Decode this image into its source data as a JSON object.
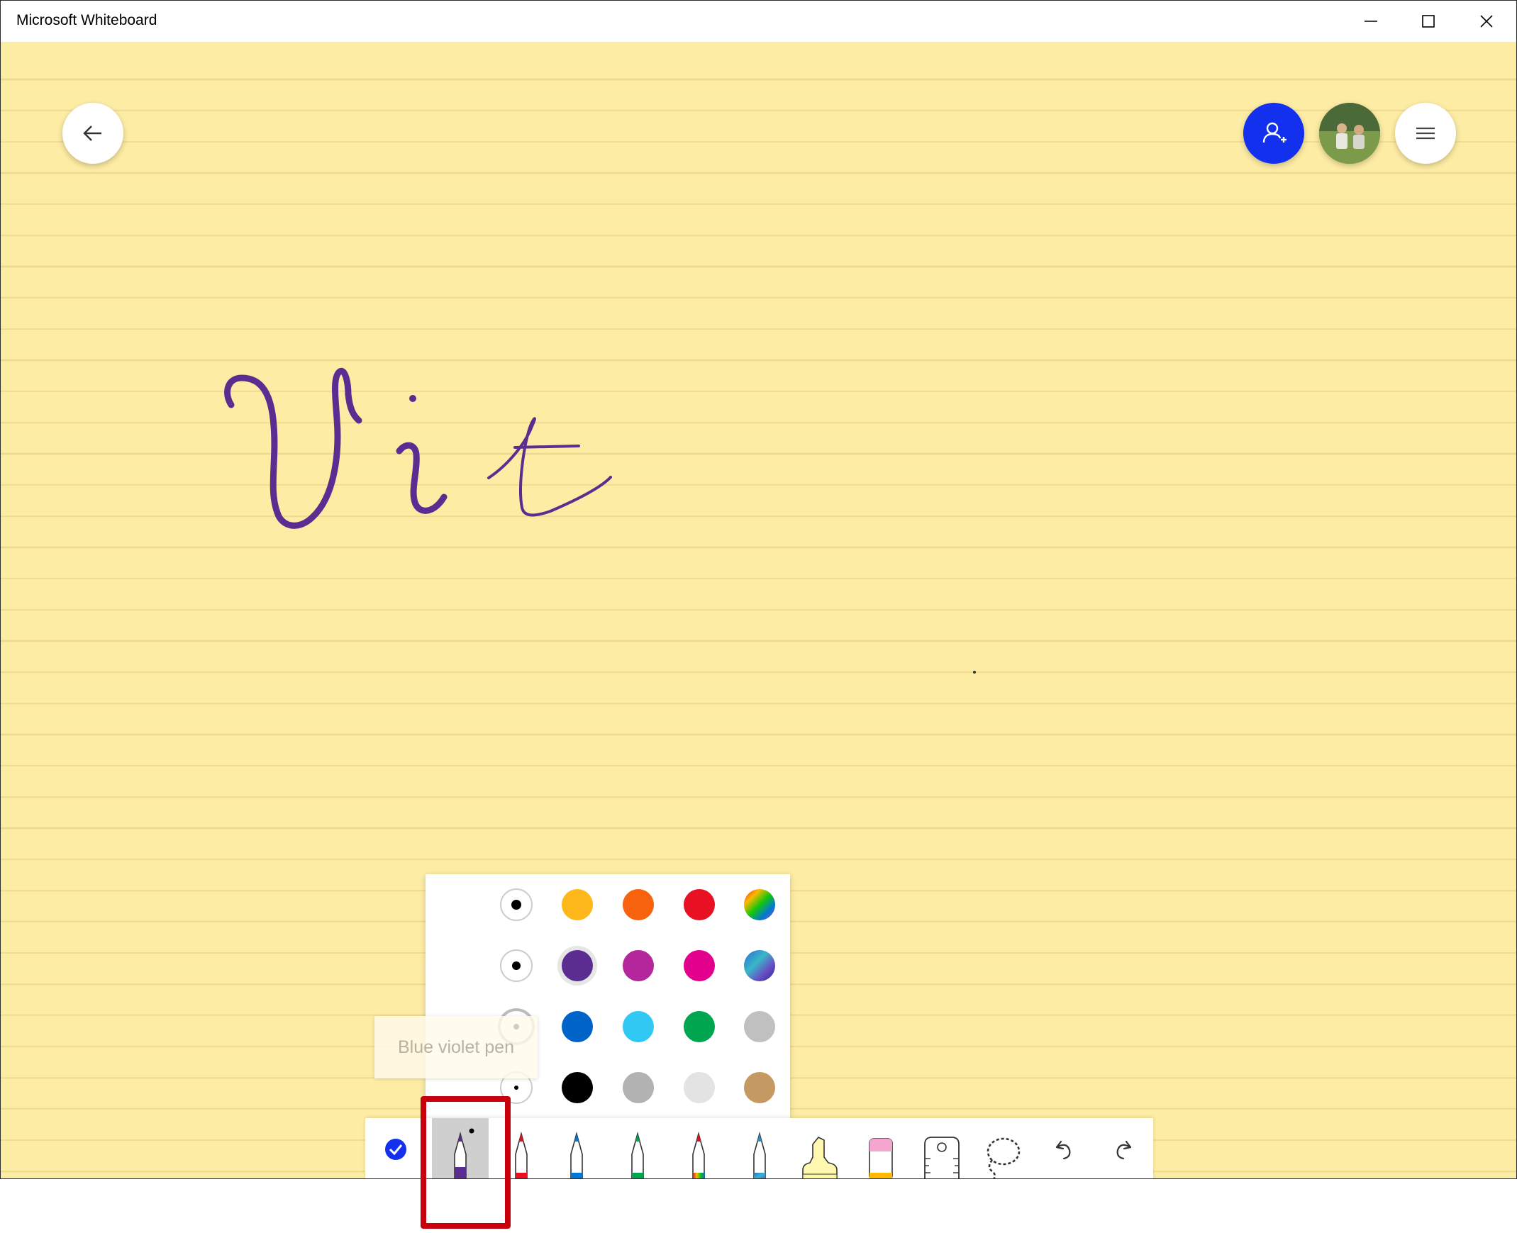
{
  "window": {
    "title": "Microsoft Whiteboard"
  },
  "canvas": {
    "background_color": "#fdeca4",
    "line_color": "#efd98f",
    "ink_color": "#5b2d91"
  },
  "pen_palette": {
    "selected_color": "#5b2d91",
    "tooltip": "Blue violet pen",
    "color_rows": [
      [
        "#ffb81c",
        "#f7630c",
        "#e81123",
        "rainbow"
      ],
      [
        "#5c2d91",
        "#b4269b",
        "#e3008c",
        "galaxy"
      ],
      [
        "#0063c7",
        "#31c8f4",
        "#00a550",
        "#c0c0c0"
      ],
      [
        "#000000",
        "#b2b2b2",
        "#e3e3e3",
        "#c49a62"
      ]
    ]
  },
  "toolbar": {
    "tools": [
      {
        "icon": "checkmark-icon",
        "selected": false
      },
      {
        "icon": "pen-icon",
        "color": "#5b2d91",
        "selected": true
      },
      {
        "icon": "pen-icon",
        "color": "#e81123"
      },
      {
        "icon": "pen-icon",
        "color": "#0078d4"
      },
      {
        "icon": "pen-icon",
        "color": "#00a550"
      },
      {
        "icon": "pen-icon",
        "color": "rainbow"
      },
      {
        "icon": "pen-icon",
        "color": "galaxy"
      },
      {
        "icon": "highlighter-icon",
        "color": "#fff6a0"
      },
      {
        "icon": "eraser-icon",
        "color": "#f3a7cf"
      },
      {
        "icon": "ruler-icon"
      },
      {
        "icon": "lasso-icon"
      },
      {
        "icon": "undo-icon"
      },
      {
        "icon": "redo-icon"
      }
    ]
  }
}
